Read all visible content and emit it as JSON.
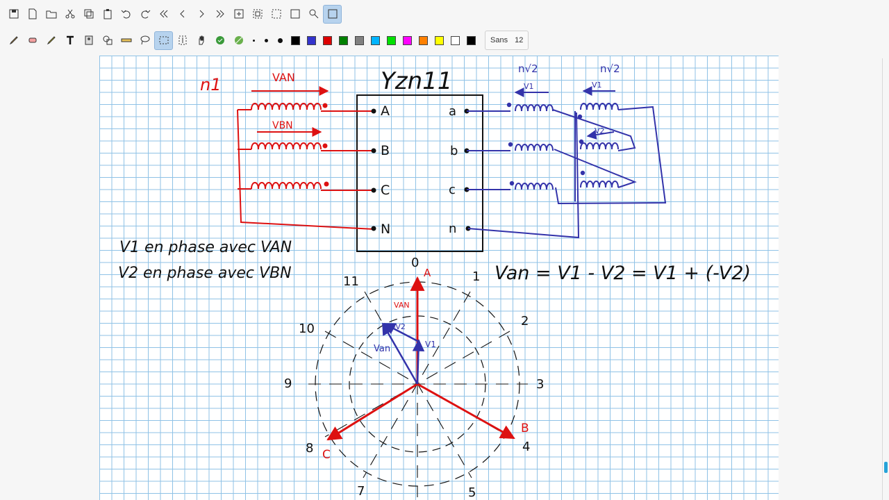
{
  "toolbar_top": {
    "icons": [
      "save-icon",
      "new-page-icon",
      "open-folder-icon",
      "cut-icon",
      "copy-icon",
      "paste-icon",
      "undo-icon",
      "redo-icon",
      "first-page-icon",
      "previous-page-icon",
      "next-page-icon",
      "last-page-icon",
      "zoom-fit-icon",
      "zoom-region-icon",
      "select-region-icon",
      "zoom-page-icon",
      "search-icon",
      "fullscreen-icon"
    ],
    "active": "fullscreen-icon"
  },
  "toolbar_tools": {
    "icons": [
      "pen-icon",
      "eraser-icon",
      "highlighter-icon",
      "text-icon",
      "image-icon",
      "shapes-icon",
      "ruler-icon",
      "lasso-icon",
      "rect-select-icon",
      "vertical-space-icon",
      "hand-icon",
      "default-tool-icon",
      "shape-recognizer-icon"
    ],
    "active": "rect-select-icon"
  },
  "pen_sizes": [
    "very-fine",
    "fine",
    "medium"
  ],
  "colors": [
    "#000000",
    "#3333cc",
    "#dd0000",
    "#008000",
    "#808080",
    "#00b4ff",
    "#00e000",
    "#ff00ff",
    "#ff8000",
    "#ffff00",
    "#ffffff",
    "#000000"
  ],
  "font": {
    "name": "Sans",
    "size": "12"
  },
  "handwriting": {
    "title": "Yzn11",
    "n1": "n1",
    "n2_left": "n√2",
    "n2_right": "n√2",
    "v_an_top": "VAN",
    "v_bn_top": "VBN",
    "v1_left": "V1",
    "v1_right": "V1",
    "v2_right": "V2",
    "terminals_primary": [
      "A",
      "B",
      "C",
      "N"
    ],
    "terminals_secondary": [
      "a",
      "b",
      "c",
      "n"
    ],
    "line1": "V1 en phase avec VAN",
    "line2": "V2 en phase avec VBN",
    "equation": "Van = V1 - V2 = V1 + (-V2)",
    "clock_numbers": [
      "0",
      "1",
      "2",
      "3",
      "4",
      "5",
      "7",
      "8",
      "9",
      "10",
      "11"
    ],
    "phasor_labels": {
      "A": "A",
      "B": "B",
      "C": "C",
      "v_an_phasor": "VAN",
      "v_an_sec": "Van",
      "neg_v2": "-V2",
      "v1": "V1"
    }
  },
  "colors_ink": {
    "red": "#dd1111",
    "blue": "#3333aa",
    "black": "#111111"
  }
}
